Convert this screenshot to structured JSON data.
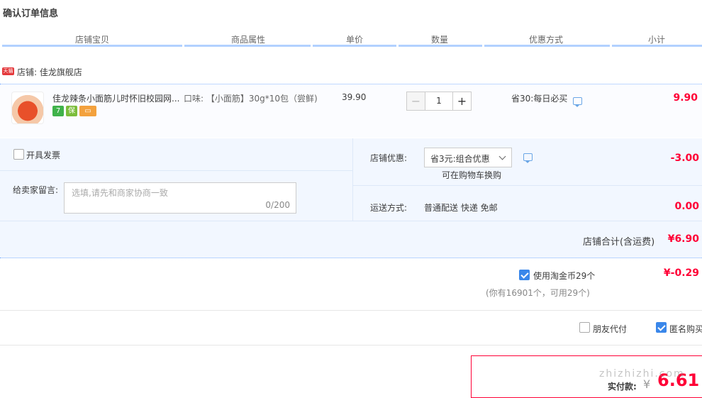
{
  "page_title": "确认订单信息",
  "columns": [
    "店铺宝贝",
    "商品属性",
    "单价",
    "数量",
    "优惠方式",
    "小计"
  ],
  "shop": {
    "badge": "天猫",
    "label": "店铺: 佳龙旗舰店"
  },
  "item": {
    "title": "佳龙辣条小面筋儿时怀旧校园网...",
    "badges": [
      {
        "text": "7",
        "color": "#3fb24a"
      },
      {
        "text": "保",
        "color": "#7bbd3a"
      },
      {
        "text": "▭",
        "color": "#f3a13d"
      }
    ],
    "property": "口味: 【小面筋】30g*10包（尝鲜)",
    "price": "39.90",
    "quantity": "1",
    "promo": "省30:每日必买",
    "subtotal": "9.90"
  },
  "invoice_label": "开具发票",
  "message": {
    "label": "给卖家留言:",
    "placeholder": "选填,请先和商家协商一致",
    "counter": "0/200"
  },
  "shop_discount": {
    "label": "店铺优惠:",
    "selected": "省3元:组合优惠",
    "hint": "可在购物车换购",
    "amount": "-3.00"
  },
  "shipping": {
    "label": "运送方式:",
    "value": "普通配送 快递 免邮",
    "amount": "0.00"
  },
  "shop_total": {
    "label": "店铺合计(含运费)",
    "amount": "¥6.90"
  },
  "coins": {
    "label": "使用淘金币29个",
    "amount": "¥-0.29",
    "note": "(你有16901个，可用29个)"
  },
  "options": {
    "friend_pay": "朋友代付",
    "anonymous": "匿名购买"
  },
  "payment": {
    "label": "实付款:",
    "currency": "¥",
    "amount": "6.61"
  },
  "watermark": "zhizhizhi.com",
  "colors": {
    "accent_red": "#ff0036",
    "accent_blue": "#3a87ea",
    "header_bar": "#b2d1ff"
  }
}
